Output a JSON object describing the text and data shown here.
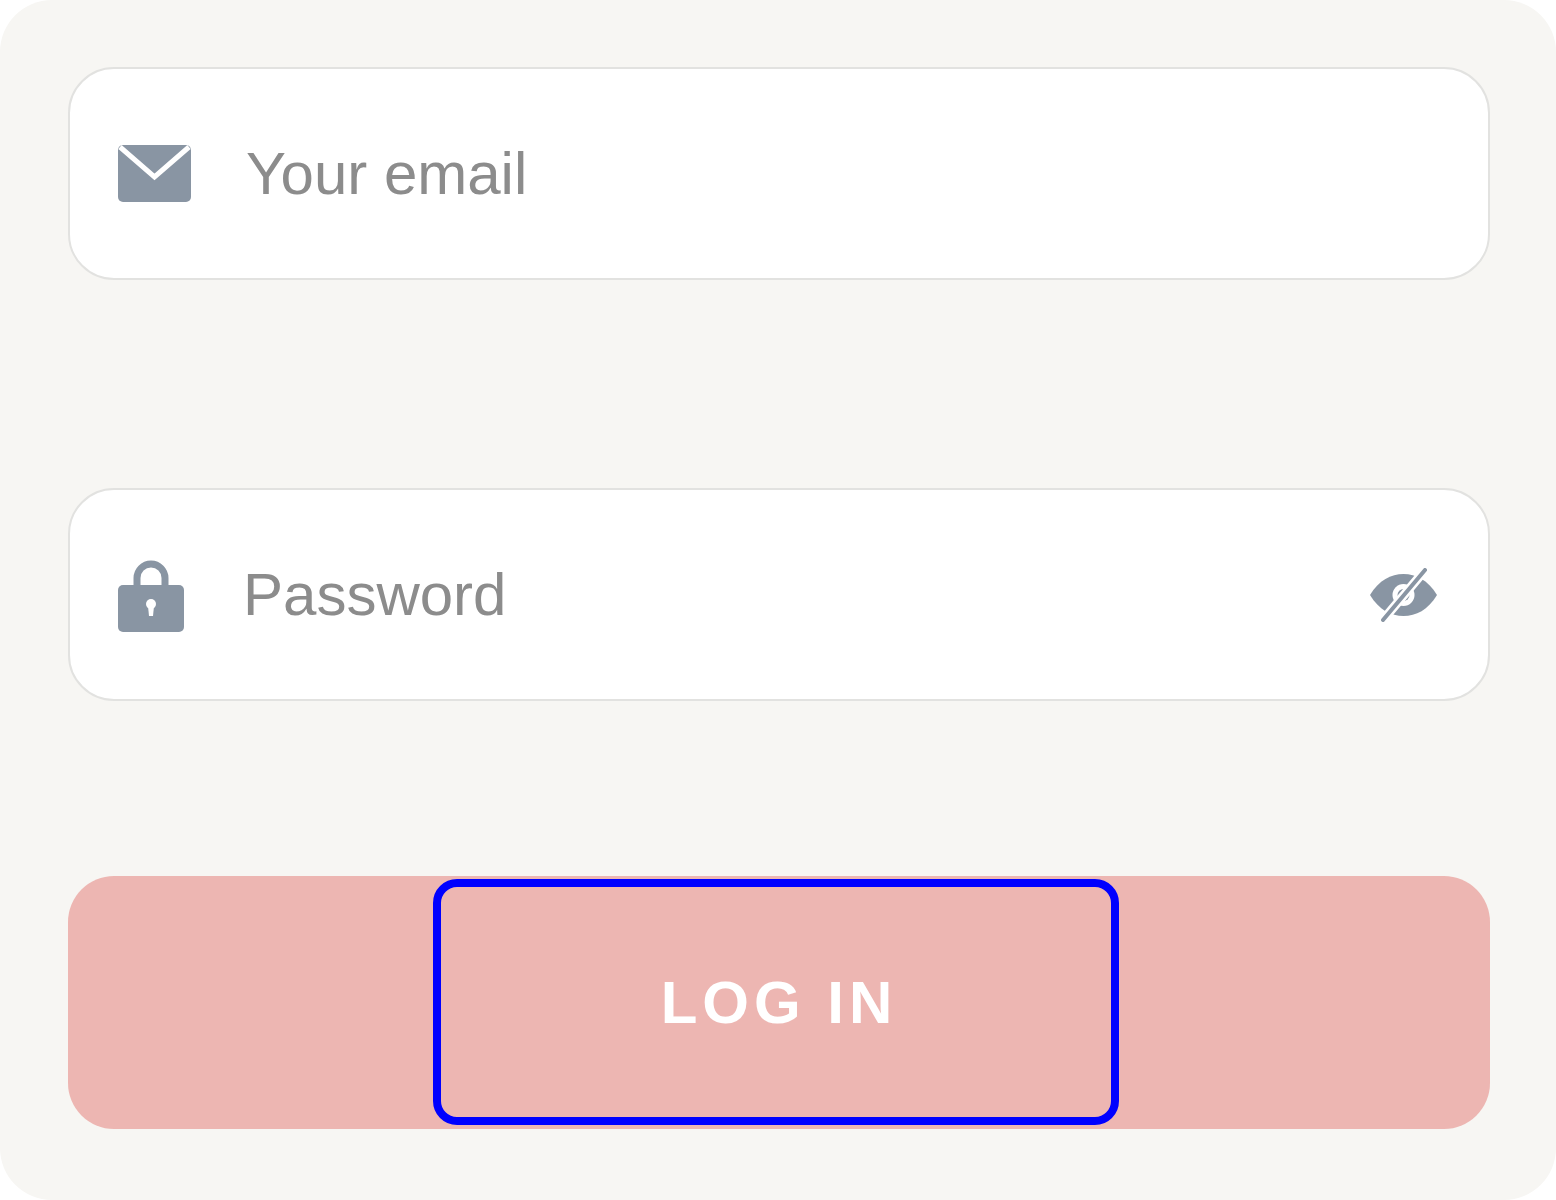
{
  "email_field": {
    "placeholder": "Your email"
  },
  "password_field": {
    "placeholder": "Password",
    "revealed": false
  },
  "login_button": {
    "label": "LOG IN",
    "focused": true
  }
}
